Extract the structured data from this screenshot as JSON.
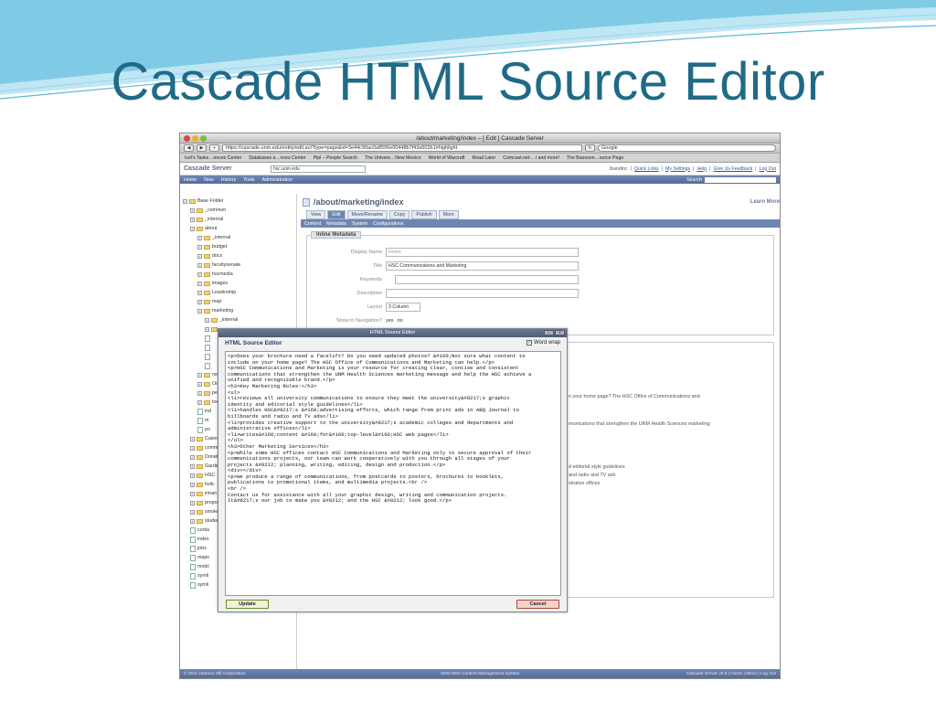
{
  "slide": {
    "title": "Cascade HTML Source Editor"
  },
  "browser": {
    "window_title": "/about/marketing/index – [ Edit ] Cascade Server",
    "url": "https://cascade.unm.edu/entity/edit.act?type=page&id=3e44c90ac0a8506e00448b7f43a602b1#highlight",
    "search_placeholder": "Google",
    "bookmarks": [
      "Icel's Tasks…ences Center",
      "Databases a…nces Center",
      "Pipl – People Search",
      "The Univers…New Mexico",
      "World of Warcraft",
      "Read Later",
      "Comcast.net:…l and more!",
      "The Bassoon…ource Page"
    ]
  },
  "cascade": {
    "logo": "Cascade Server",
    "site": "hsc.unm.edu",
    "user_links": {
      "user": "lbandinc",
      "quick_links": "Quick Links",
      "settings": "My Settings",
      "help": "Help",
      "feedback": "Give Us Feedback",
      "logout": "Log Out"
    },
    "menu": [
      "Home",
      "New",
      "History",
      "Tools",
      "Administration"
    ],
    "search_label": "Search"
  },
  "tree": [
    {
      "label": "Base Folder",
      "indent": 0,
      "kind": "folder"
    },
    {
      "label": "_common",
      "indent": 1,
      "kind": "folder"
    },
    {
      "label": "_internal",
      "indent": 1,
      "kind": "folder"
    },
    {
      "label": "about",
      "indent": 1,
      "kind": "folder"
    },
    {
      "label": "_internal",
      "indent": 2,
      "kind": "folder"
    },
    {
      "label": "budget",
      "indent": 2,
      "kind": "folder"
    },
    {
      "label": "docs",
      "indent": 2,
      "kind": "folder"
    },
    {
      "label": "facultysenate",
      "indent": 2,
      "kind": "folder"
    },
    {
      "label": "hscmedia",
      "indent": 2,
      "kind": "folder"
    },
    {
      "label": "images",
      "indent": 2,
      "kind": "folder"
    },
    {
      "label": "Leadership",
      "indent": 2,
      "kind": "folder"
    },
    {
      "label": "map",
      "indent": 2,
      "kind": "folder"
    },
    {
      "label": "marketing",
      "indent": 2,
      "kind": "folder"
    },
    {
      "label": "_internal",
      "indent": 3,
      "kind": "folder"
    },
    {
      "label": "",
      "indent": 3,
      "kind": "folder"
    },
    {
      "label": "",
      "indent": 3,
      "kind": "doc"
    },
    {
      "label": "",
      "indent": 3,
      "kind": "doc"
    },
    {
      "label": "",
      "indent": 3,
      "kind": "doc"
    },
    {
      "label": "",
      "indent": 3,
      "kind": "doc"
    },
    {
      "label": "ne",
      "indent": 2,
      "kind": "folder"
    },
    {
      "label": "Or",
      "indent": 2,
      "kind": "folder"
    },
    {
      "label": "pe",
      "indent": 2,
      "kind": "folder"
    },
    {
      "label": "tox",
      "indent": 2,
      "kind": "folder"
    },
    {
      "label": "ind",
      "indent": 2,
      "kind": "doc"
    },
    {
      "label": "m",
      "indent": 2,
      "kind": "doc"
    },
    {
      "label": "po",
      "indent": 2,
      "kind": "doc"
    },
    {
      "label": "Calen",
      "indent": 1,
      "kind": "folder"
    },
    {
      "label": "comm",
      "indent": 1,
      "kind": "folder"
    },
    {
      "label": "Donat",
      "indent": 1,
      "kind": "folder"
    },
    {
      "label": "Garde",
      "indent": 1,
      "kind": "folder"
    },
    {
      "label": "HSC",
      "indent": 1,
      "kind": "folder"
    },
    {
      "label": "hslic",
      "indent": 1,
      "kind": "folder"
    },
    {
      "label": "intran",
      "indent": 1,
      "kind": "folder"
    },
    {
      "label": "progra",
      "indent": 1,
      "kind": "folder"
    },
    {
      "label": "smoke",
      "indent": 1,
      "kind": "folder"
    },
    {
      "label": "studen",
      "indent": 1,
      "kind": "folder"
    },
    {
      "label": "conta",
      "indent": 1,
      "kind": "doc"
    },
    {
      "label": "index",
      "indent": 1,
      "kind": "doc"
    },
    {
      "label": "jobs",
      "indent": 1,
      "kind": "doc"
    },
    {
      "label": "maps",
      "indent": 1,
      "kind": "doc"
    },
    {
      "label": "mobil",
      "indent": 1,
      "kind": "doc"
    },
    {
      "label": "symli",
      "indent": 1,
      "kind": "doc"
    },
    {
      "label": "symli",
      "indent": 1,
      "kind": "doc"
    }
  ],
  "main": {
    "path": "/about/marketing/index",
    "learn_more": "Learn More",
    "tabs": [
      "View",
      "Edit",
      "Move/Rename",
      "Copy",
      "Publish",
      "More"
    ],
    "subtabs": [
      "Content",
      "Metadata",
      "System",
      "Configurations"
    ],
    "legend": "Inline Metadata",
    "fields": {
      "display_name_label": "Display Name",
      "display_name_value": "Home",
      "title_label": "Title",
      "title_value": "HSC Communications and Marketing",
      "keywords_label": "Keywords",
      "description_label": "Description",
      "layout_label": "Layout",
      "layout_value": "3 Column",
      "nav_label": "Show in Navigation?",
      "nav_yes": "yes",
      "nav_no": "no"
    },
    "bg_lines": [
      "n your home page? The HSC Office of Communications and",
      "munications that strengthen the UNM Health Sciences marketing",
      "d editorial style guidelines",
      "and radio and TV ads",
      "strative offices"
    ]
  },
  "modal": {
    "window_title": "HTML Source Editor",
    "heading": "HTML Source Editor",
    "word_wrap": "Word wrap",
    "source": "<p>Does your brochure need a facelift? Do you need updated photos? &#160;Not sure what content to\ninclude on your home page? The HSC Office of Communications and Marketing can help.</p>\n<p>HSC Communications and Marketing is your resource for creating clear, concise and consistent\ncommunications that strengthen the UNM Health Sciences marketing message and help the HSC achieve a\nunified and recognizable brand.</p>\n<h3>Key Marketing Roles:</h3>\n<ul>\n<li>reviews all university communications to ensure they meet the university&#8217;s graphic\nidentity and editorial style guidelines</li>\n<li>handles HSC&#8217;s &#160;advertising efforts, which range from print ads in ABQ Journal to\nbillboards and radio and TV ads</li>\n<li>provides creative support to the university&#8217;s academic colleges and departments and\nadministrative offices</li>\n<li>writes&#160;content &#160;for&#160;top-level&#160;HSC web pages</li>\n</ul>\n<h3>Other Marketing Services</h3>\n<p>While some HSC offices contact HSC Communications and Marketing only to secure approval of their\ncommunications projects, our team can work cooperatively with you through all stages of your\nprojects &#8212; planning, writing, editing, design and production.</p>\n<div></div>\n<p>We produce a range of communications, from postcards to posters, brochures to booklets,\npublications to promotional items, and multimedia projects.<br />\n<br />\nContact us for assistance with all your graphic design, writing and communication projects.\nIt&#8217;s our job to make you &#8212; and the HSC &#8212; look good.</p>",
    "update_label": "Update",
    "cancel_label": "Cancel"
  },
  "footer": {
    "left": "© 2011 Hannon Hill Corporation",
    "middle": "UNM Web Content Management System",
    "right": "Cascade Server v6.8 | Home | Menu | Log Out"
  }
}
